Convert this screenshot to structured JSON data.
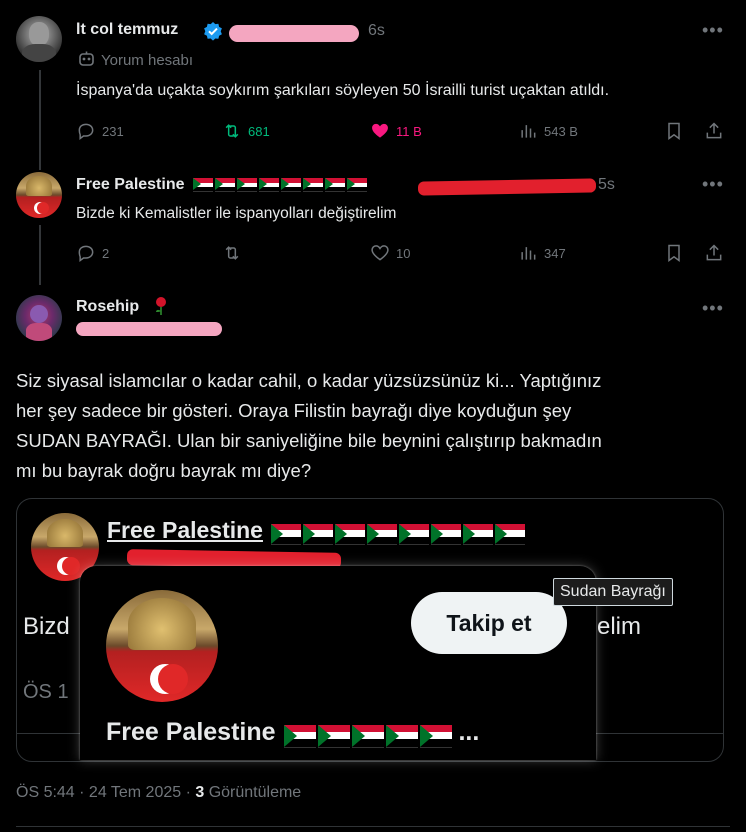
{
  "tweet1": {
    "name": "lt col temmuz",
    "time": "6s",
    "subtitle": "Yorum hesabı",
    "text": "İspanya'da uçakta soykırım şarkıları söyleyen 50 İsrailli turist uçaktan atıldı.",
    "replies": "231",
    "retweets": "681",
    "likes": "11 B",
    "views": "543 B"
  },
  "tweet2": {
    "name": "Free Palestine",
    "time": "5s",
    "text": "Bizde ki Kemalistler ile ispanyolları değiştirelim",
    "replies": "2",
    "likes": "10",
    "views": "347"
  },
  "tweet3": {
    "name": "Rosehip",
    "text_lines": [
      "Siz siyasal islamcılar o kadar cahil, o kadar yüzsüzsünüz ki... Yaptığınız",
      "her şey sadece bir gösteri. Oraya Filistin bayrağı diye koyduğun şey",
      "SUDAN BAYRAĞI. Ulan bir saniyeliğine bile beynini çalıştırıp bakmadın",
      "mı bu bayrak doğru bayrak mı diye?"
    ],
    "timestamp": "ÖS 5:44 · 24 Tem 2025 · ",
    "views_count": "3",
    "views_label": " Görüntüleme"
  },
  "quote": {
    "name": "Free Palestine",
    "text_left": "Bizd",
    "text_right": "elim",
    "time_partial": "ÖS 1"
  },
  "hovercard": {
    "name": "Free Palestine",
    "follow_label": "Takip et",
    "ellipsis": "..."
  },
  "tooltip": {
    "text": "Sudan Bayrağı"
  },
  "colors": {
    "retweet_green": "#00ba7c",
    "like_pink": "#f91880",
    "verified_blue": "#1d9bf0"
  }
}
